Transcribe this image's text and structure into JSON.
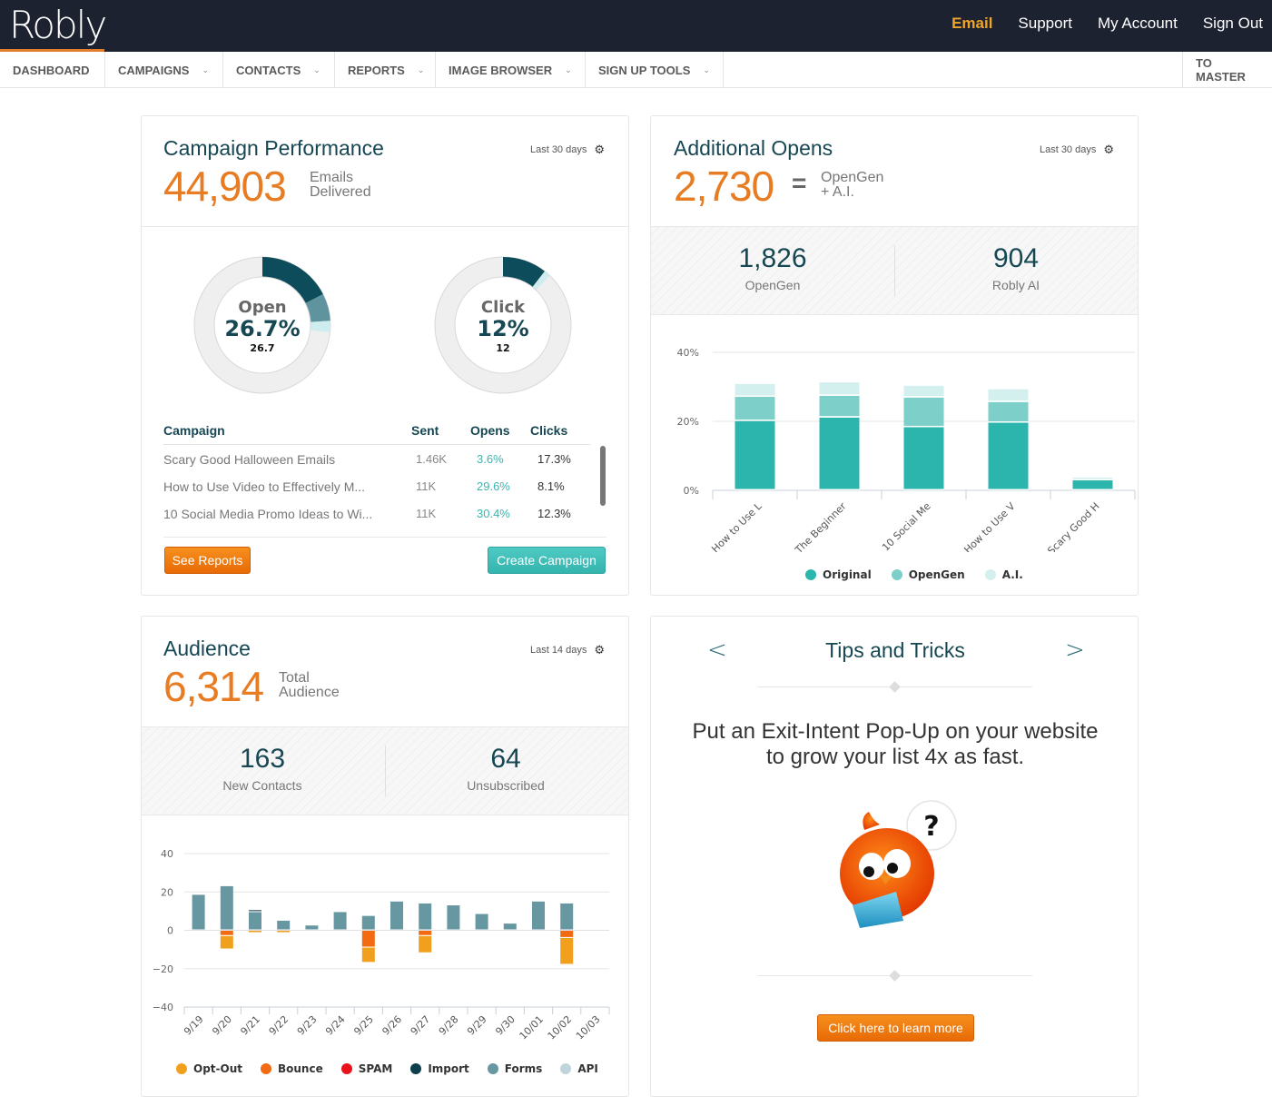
{
  "app": {
    "logo": "Robly"
  },
  "topnav": {
    "links": [
      {
        "label": "Email",
        "active": true
      },
      {
        "label": "Support"
      },
      {
        "label": "My Account"
      },
      {
        "label": "Sign Out"
      }
    ]
  },
  "nav": {
    "items": [
      {
        "label": "DASHBOARD",
        "active": true
      },
      {
        "label": "CAMPAIGNS",
        "dropdown": true
      },
      {
        "label": "CONTACTS",
        "dropdown": true
      },
      {
        "label": "REPORTS",
        "dropdown": true
      },
      {
        "label": "IMAGE BROWSER",
        "dropdown": true
      },
      {
        "label": "SIGN UP TOOLS",
        "dropdown": true
      }
    ],
    "right_item": "TO MASTER",
    "chevron": "⌄"
  },
  "campaign_performance": {
    "title": "Campaign Performance",
    "range": "Last 30 days",
    "total": "44,903",
    "total_label_1": "Emails",
    "total_label_2": "Delivered",
    "open_donut": {
      "label": "Open",
      "percent": "26.7%",
      "raw": "26.7",
      "segments": [
        {
          "value": 17.5,
          "color": "#0d4c5b"
        },
        {
          "value": 6.5,
          "color": "#5f949e"
        },
        {
          "value": 2.7,
          "color": "#cfecee"
        }
      ]
    },
    "click_donut": {
      "label": "Click",
      "percent": "12%",
      "raw": "12",
      "segments": [
        {
          "value": 10.5,
          "color": "#0d4c5b"
        },
        {
          "value": 1.5,
          "color": "#cfecee"
        }
      ]
    },
    "table": {
      "headers": {
        "campaign": "Campaign",
        "sent": "Sent",
        "opens": "Opens",
        "clicks": "Clicks"
      },
      "rows": [
        {
          "campaign": "Scary Good Halloween Emails",
          "sent": "1.46K",
          "opens": "3.6%",
          "clicks": "17.3%"
        },
        {
          "campaign": "How to Use Video to Effectively M...",
          "sent": "11K",
          "opens": "29.6%",
          "clicks": "8.1%"
        },
        {
          "campaign": "10 Social Media Promo Ideas to Wi...",
          "sent": "11K",
          "opens": "30.4%",
          "clicks": "12.3%"
        }
      ]
    },
    "see_reports": "See Reports",
    "create_campaign": "Create Campaign"
  },
  "additional_opens": {
    "title": "Additional Opens",
    "range": "Last 30 days",
    "total": "2,730",
    "equals": "=",
    "total_label_1": "OpenGen",
    "total_label_2": "+ A.I.",
    "stats": [
      {
        "value": "1,826",
        "label": "OpenGen"
      },
      {
        "value": "904",
        "label": "Robly AI"
      }
    ]
  },
  "audience": {
    "title": "Audience",
    "range": "Last 14 days",
    "total": "6,314",
    "total_label_1": "Total",
    "total_label_2": "Audience",
    "stats": [
      {
        "value": "163",
        "label": "New Contacts"
      },
      {
        "value": "64",
        "label": "Unsubscribed"
      }
    ]
  },
  "tips": {
    "title": "Tips and Tricks",
    "prev": "<",
    "next": ">",
    "text": "Put an Exit-Intent Pop-Up on your website to grow your list 4x as fast.",
    "cta": "Click here to learn more",
    "bubble": "?"
  },
  "chart_data": [
    {
      "id": "opens-chart",
      "type": "bar",
      "stacked": true,
      "title": "",
      "xlabel": "",
      "ylabel": "",
      "categories": [
        "How to Use L",
        "The Beginner",
        "10 Social Me",
        "How to Use V",
        "Scary Good H"
      ],
      "series": [
        {
          "name": "Original",
          "color": "#2bb5ac",
          "values": [
            20.1,
            21.1,
            18.3,
            19.6,
            2.9
          ]
        },
        {
          "name": "OpenGen",
          "color": "#7dcfc9",
          "values": [
            7.0,
            6.3,
            8.6,
            6.0,
            0
          ]
        },
        {
          "name": "A.I.",
          "color": "#d3f0ef",
          "values": [
            3.7,
            3.9,
            3.4,
            3.7,
            0.8
          ]
        }
      ],
      "ylim": [
        0,
        40
      ],
      "yticks": [
        "0%",
        "20%",
        "40%"
      ],
      "ytick_values": [
        0,
        20,
        40
      ],
      "grid": true,
      "legend": "bottom"
    },
    {
      "id": "audience-chart",
      "type": "bar",
      "stacked": true,
      "title": "",
      "xlabel": "",
      "ylabel": "",
      "categories": [
        "9/19",
        "9/20",
        "9/21",
        "9/22",
        "9/23",
        "9/24",
        "9/25",
        "9/26",
        "9/27",
        "9/28",
        "9/29",
        "9/30",
        "10/01",
        "10/02",
        "10/03"
      ],
      "series": [
        {
          "name": "Opt-Out",
          "color": "#f0a01c",
          "values": [
            0,
            -7,
            -1.5,
            -1.5,
            0,
            0,
            -8,
            0,
            -9,
            -0.5,
            -0.5,
            0,
            0,
            -14,
            0
          ]
        },
        {
          "name": "Bounce",
          "color": "#f26a12",
          "values": [
            0,
            -3,
            0,
            0,
            0,
            0,
            -9,
            0,
            -3,
            0,
            0,
            0,
            0,
            -4,
            0
          ]
        },
        {
          "name": "SPAM",
          "color": "#e8111c",
          "values": [
            0,
            0,
            0,
            0,
            0,
            0,
            0,
            0,
            0,
            0,
            0,
            0,
            0,
            0,
            0
          ]
        },
        {
          "name": "Import",
          "color": "#0d3e4c",
          "values": [
            0,
            0,
            1,
            0,
            0,
            0,
            0,
            0,
            0,
            0,
            0,
            0,
            0,
            0,
            0
          ]
        },
        {
          "name": "Forms",
          "color": "#6797a0",
          "values": [
            18.5,
            23,
            9.5,
            5,
            2.5,
            9.5,
            7.5,
            15,
            14,
            13,
            8.5,
            3.5,
            15,
            14,
            0
          ]
        },
        {
          "name": "API",
          "color": "#c0d5da",
          "values": [
            0,
            0,
            0,
            0,
            0,
            0,
            0,
            0,
            0,
            0,
            0,
            0,
            0,
            0,
            0
          ]
        }
      ],
      "ylim": [
        -40,
        40
      ],
      "yticks": [
        "−40",
        "−20",
        "0",
        "20",
        "40"
      ],
      "ytick_values": [
        -40,
        -20,
        0,
        20,
        40
      ],
      "grid": true,
      "legend": "bottom"
    }
  ]
}
